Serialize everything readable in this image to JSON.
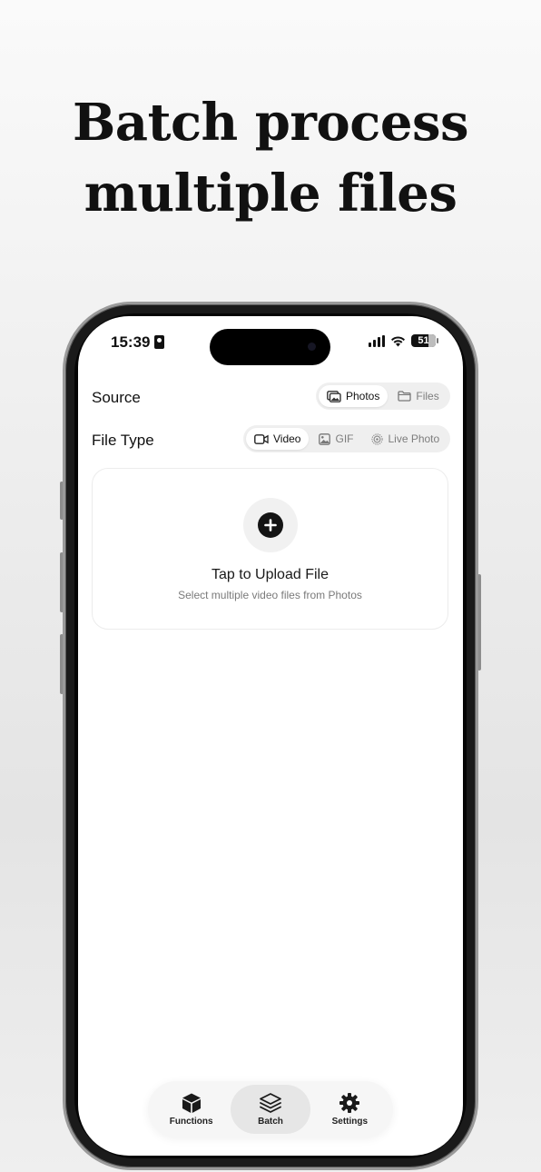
{
  "headline": {
    "line1": "Batch process",
    "line2": "multiple files"
  },
  "status_bar": {
    "time": "15:39",
    "battery": "51"
  },
  "source": {
    "label": "Source",
    "options": [
      {
        "label": "Photos",
        "icon": "photos-icon",
        "selected": true
      },
      {
        "label": "Files",
        "icon": "folder-icon",
        "selected": false
      }
    ]
  },
  "file_type": {
    "label": "File Type",
    "options": [
      {
        "label": "Video",
        "icon": "video-icon",
        "selected": true
      },
      {
        "label": "GIF",
        "icon": "image-icon",
        "selected": false
      },
      {
        "label": "Live Photo",
        "icon": "live-photo-icon",
        "selected": false
      }
    ]
  },
  "upload": {
    "title": "Tap to Upload File",
    "subtitle": "Select multiple video files from Photos",
    "icon": "plus-icon"
  },
  "tabbar": {
    "items": [
      {
        "label": "Functions",
        "icon": "cube-icon",
        "active": false
      },
      {
        "label": "Batch",
        "icon": "layers-icon",
        "active": true
      },
      {
        "label": "Settings",
        "icon": "gear-icon",
        "active": false
      }
    ]
  },
  "colors": {
    "accent": "#111111",
    "segment_bg": "#efefef",
    "active_tab_bg": "#e6e6e6"
  }
}
